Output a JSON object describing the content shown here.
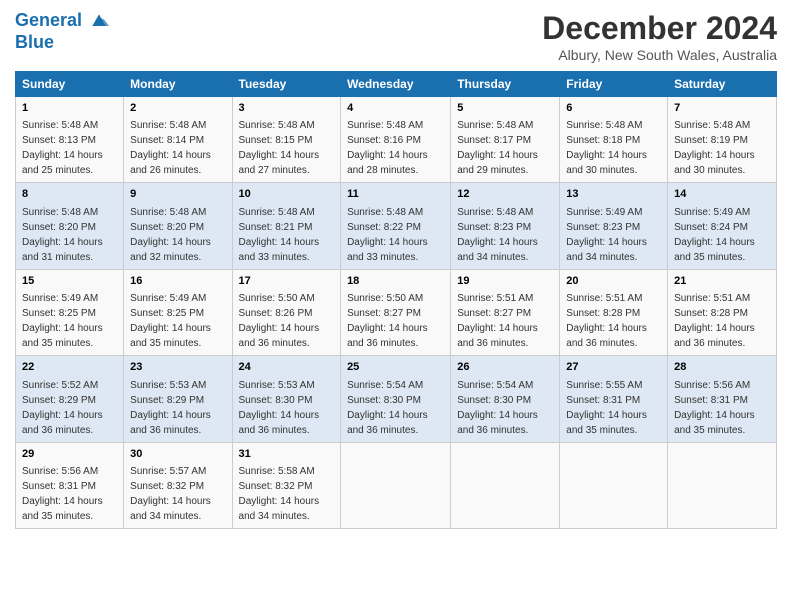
{
  "logo": {
    "line1": "General",
    "line2": "Blue"
  },
  "title": "December 2024",
  "subtitle": "Albury, New South Wales, Australia",
  "weekdays": [
    "Sunday",
    "Monday",
    "Tuesday",
    "Wednesday",
    "Thursday",
    "Friday",
    "Saturday"
  ],
  "weeks": [
    [
      {
        "day": "1",
        "sunrise": "5:48 AM",
        "sunset": "8:13 PM",
        "daylight": "14 hours and 25 minutes."
      },
      {
        "day": "2",
        "sunrise": "5:48 AM",
        "sunset": "8:14 PM",
        "daylight": "14 hours and 26 minutes."
      },
      {
        "day": "3",
        "sunrise": "5:48 AM",
        "sunset": "8:15 PM",
        "daylight": "14 hours and 27 minutes."
      },
      {
        "day": "4",
        "sunrise": "5:48 AM",
        "sunset": "8:16 PM",
        "daylight": "14 hours and 28 minutes."
      },
      {
        "day": "5",
        "sunrise": "5:48 AM",
        "sunset": "8:17 PM",
        "daylight": "14 hours and 29 minutes."
      },
      {
        "day": "6",
        "sunrise": "5:48 AM",
        "sunset": "8:18 PM",
        "daylight": "14 hours and 30 minutes."
      },
      {
        "day": "7",
        "sunrise": "5:48 AM",
        "sunset": "8:19 PM",
        "daylight": "14 hours and 30 minutes."
      }
    ],
    [
      {
        "day": "8",
        "sunrise": "5:48 AM",
        "sunset": "8:20 PM",
        "daylight": "14 hours and 31 minutes."
      },
      {
        "day": "9",
        "sunrise": "5:48 AM",
        "sunset": "8:20 PM",
        "daylight": "14 hours and 32 minutes."
      },
      {
        "day": "10",
        "sunrise": "5:48 AM",
        "sunset": "8:21 PM",
        "daylight": "14 hours and 33 minutes."
      },
      {
        "day": "11",
        "sunrise": "5:48 AM",
        "sunset": "8:22 PM",
        "daylight": "14 hours and 33 minutes."
      },
      {
        "day": "12",
        "sunrise": "5:48 AM",
        "sunset": "8:23 PM",
        "daylight": "14 hours and 34 minutes."
      },
      {
        "day": "13",
        "sunrise": "5:49 AM",
        "sunset": "8:23 PM",
        "daylight": "14 hours and 34 minutes."
      },
      {
        "day": "14",
        "sunrise": "5:49 AM",
        "sunset": "8:24 PM",
        "daylight": "14 hours and 35 minutes."
      }
    ],
    [
      {
        "day": "15",
        "sunrise": "5:49 AM",
        "sunset": "8:25 PM",
        "daylight": "14 hours and 35 minutes."
      },
      {
        "day": "16",
        "sunrise": "5:49 AM",
        "sunset": "8:25 PM",
        "daylight": "14 hours and 35 minutes."
      },
      {
        "day": "17",
        "sunrise": "5:50 AM",
        "sunset": "8:26 PM",
        "daylight": "14 hours and 36 minutes."
      },
      {
        "day": "18",
        "sunrise": "5:50 AM",
        "sunset": "8:27 PM",
        "daylight": "14 hours and 36 minutes."
      },
      {
        "day": "19",
        "sunrise": "5:51 AM",
        "sunset": "8:27 PM",
        "daylight": "14 hours and 36 minutes."
      },
      {
        "day": "20",
        "sunrise": "5:51 AM",
        "sunset": "8:28 PM",
        "daylight": "14 hours and 36 minutes."
      },
      {
        "day": "21",
        "sunrise": "5:51 AM",
        "sunset": "8:28 PM",
        "daylight": "14 hours and 36 minutes."
      }
    ],
    [
      {
        "day": "22",
        "sunrise": "5:52 AM",
        "sunset": "8:29 PM",
        "daylight": "14 hours and 36 minutes."
      },
      {
        "day": "23",
        "sunrise": "5:53 AM",
        "sunset": "8:29 PM",
        "daylight": "14 hours and 36 minutes."
      },
      {
        "day": "24",
        "sunrise": "5:53 AM",
        "sunset": "8:30 PM",
        "daylight": "14 hours and 36 minutes."
      },
      {
        "day": "25",
        "sunrise": "5:54 AM",
        "sunset": "8:30 PM",
        "daylight": "14 hours and 36 minutes."
      },
      {
        "day": "26",
        "sunrise": "5:54 AM",
        "sunset": "8:30 PM",
        "daylight": "14 hours and 36 minutes."
      },
      {
        "day": "27",
        "sunrise": "5:55 AM",
        "sunset": "8:31 PM",
        "daylight": "14 hours and 35 minutes."
      },
      {
        "day": "28",
        "sunrise": "5:56 AM",
        "sunset": "8:31 PM",
        "daylight": "14 hours and 35 minutes."
      }
    ],
    [
      {
        "day": "29",
        "sunrise": "5:56 AM",
        "sunset": "8:31 PM",
        "daylight": "14 hours and 35 minutes."
      },
      {
        "day": "30",
        "sunrise": "5:57 AM",
        "sunset": "8:32 PM",
        "daylight": "14 hours and 34 minutes."
      },
      {
        "day": "31",
        "sunrise": "5:58 AM",
        "sunset": "8:32 PM",
        "daylight": "14 hours and 34 minutes."
      },
      null,
      null,
      null,
      null
    ]
  ]
}
